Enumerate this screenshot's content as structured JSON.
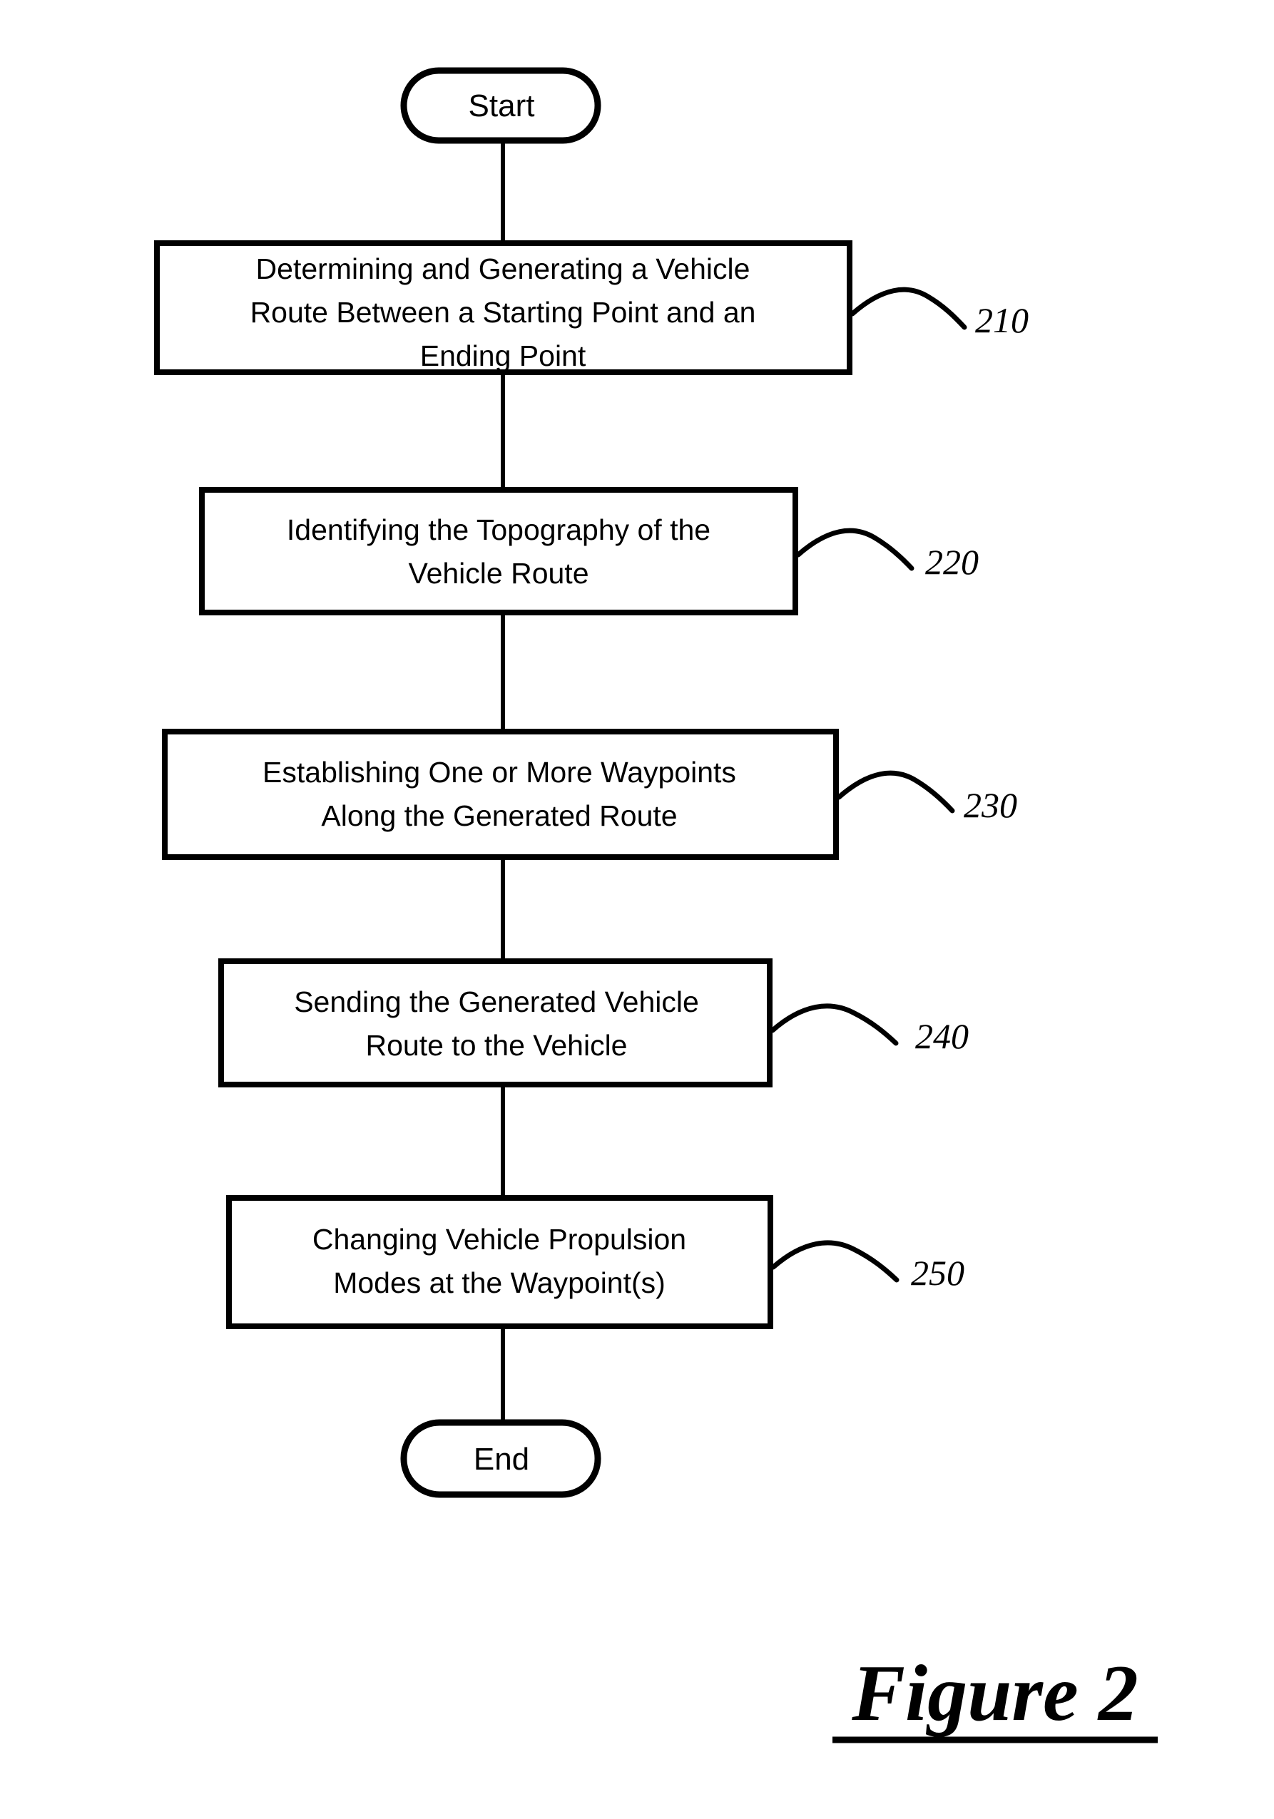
{
  "figure": {
    "caption": "Figure 2",
    "type": "patent-flowchart"
  },
  "chart_data": {
    "type": "diagram",
    "title": "Figure 2",
    "diagram_kind": "flowchart",
    "orientation": "vertical",
    "nodes": [
      {
        "id": "start",
        "shape": "terminator",
        "label": "Start",
        "ref": null
      },
      {
        "id": "step210",
        "shape": "process",
        "label": "Determining and Generating a Vehicle Route Between a Starting Point and an Ending Point",
        "ref": "210"
      },
      {
        "id": "step220",
        "shape": "process",
        "label": "Identifying the Topography of the Vehicle Route",
        "ref": "220"
      },
      {
        "id": "step230",
        "shape": "process",
        "label": "Establishing One or More Waypoints Along the Generated Route",
        "ref": "230"
      },
      {
        "id": "step240",
        "shape": "process",
        "label": "Sending the Generated Vehicle Route to the Vehicle",
        "ref": "240"
      },
      {
        "id": "step250",
        "shape": "process",
        "label": "Changing Vehicle Propulsion Modes at the Waypoint(s)",
        "ref": "250"
      },
      {
        "id": "end",
        "shape": "terminator",
        "label": "End",
        "ref": null
      }
    ],
    "edges": [
      {
        "from": "start",
        "to": "step210"
      },
      {
        "from": "step210",
        "to": "step220"
      },
      {
        "from": "step220",
        "to": "step230"
      },
      {
        "from": "step230",
        "to": "step240"
      },
      {
        "from": "step240",
        "to": "step250"
      },
      {
        "from": "step250",
        "to": "end"
      }
    ]
  },
  "terminators": {
    "start": {
      "label": "Start"
    },
    "end": {
      "label": "End"
    }
  },
  "steps": [
    {
      "ref": "210",
      "line1": "Determining and Generating a Vehicle",
      "line2": "Route Between a Starting Point and an",
      "line3": "Ending Point"
    },
    {
      "ref": "220",
      "line1": "Identifying the Topography of the",
      "line2": "Vehicle Route",
      "line3": ""
    },
    {
      "ref": "230",
      "line1": "Establishing One or More Waypoints",
      "line2": "Along the Generated Route",
      "line3": ""
    },
    {
      "ref": "240",
      "line1": "Sending the Generated Vehicle",
      "line2": "Route to the Vehicle",
      "line3": ""
    },
    {
      "ref": "250",
      "line1": "Changing Vehicle Propulsion",
      "line2": "Modes at the Waypoint(s)",
      "line3": ""
    }
  ],
  "colors": {
    "stroke": "#000000",
    "fill": "#ffffff",
    "background": "#ffffff"
  }
}
